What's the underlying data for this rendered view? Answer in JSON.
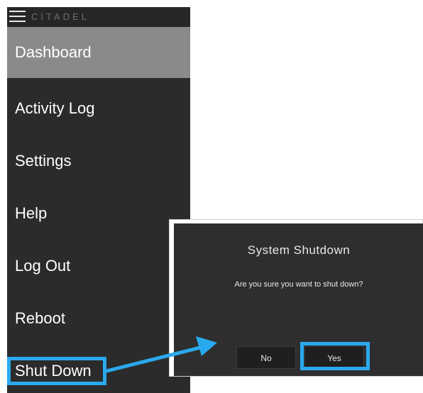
{
  "app": {
    "brand": "CITADEL"
  },
  "sidebar": {
    "items": [
      {
        "label": "Dashboard",
        "active": true
      },
      {
        "label": "Activity Log"
      },
      {
        "label": "Settings"
      },
      {
        "label": "Help"
      },
      {
        "label": "Log Out"
      },
      {
        "label": "Reboot"
      },
      {
        "label": "Shut Down"
      }
    ]
  },
  "dialog": {
    "title": "System Shutdown",
    "message": "Are you sure you want to shut down?",
    "no_label": "No",
    "yes_label": "Yes"
  },
  "colors": {
    "sidebar_bg": "#2b2b2b",
    "active_item_bg": "#8a8a8a",
    "dialog_bg": "#2e2e2e",
    "highlight": "#2aa9ee"
  }
}
